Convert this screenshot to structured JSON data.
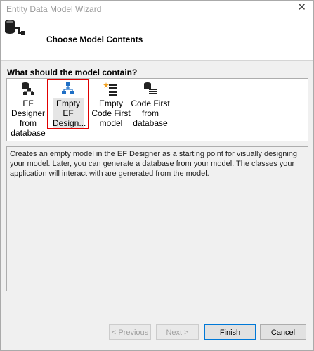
{
  "window": {
    "title": "Entity Data Model Wizard",
    "close_glyph": "✕"
  },
  "header": {
    "title": "Choose Model Contents",
    "icon": "database-connect-icon"
  },
  "question": "What should the model contain?",
  "options": [
    {
      "label": "EF Designer from database",
      "icon": "ef-designer-database-icon"
    },
    {
      "label": "Empty EF Design...",
      "icon": "empty-ef-designer-icon",
      "selected": true
    },
    {
      "label": "Empty Code First model",
      "icon": "empty-code-first-icon"
    },
    {
      "label": "Code First from database",
      "icon": "code-first-database-icon"
    }
  ],
  "description": "Creates an empty model in the EF Designer as a starting point for visually designing your model. Later, you can generate a database from your model. The classes your application will interact with are generated from the model.",
  "buttons": {
    "previous": "< Previous",
    "next": "Next >",
    "finish": "Finish",
    "cancel": "Cancel"
  },
  "colors": {
    "selection_highlight": "#e00000",
    "accent": "#0078d7"
  }
}
